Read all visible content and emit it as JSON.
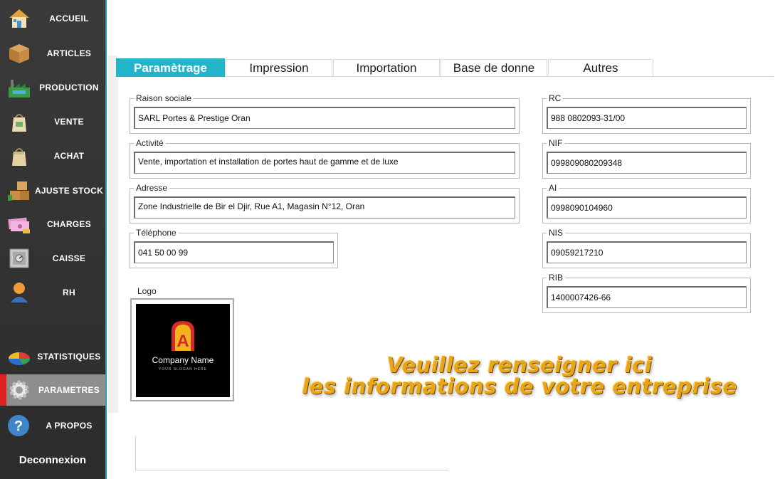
{
  "sidebar": {
    "items": [
      {
        "label": "ACCUEIL",
        "icon": "house-icon"
      },
      {
        "label": "ARTICLES",
        "icon": "wooden-crate-icon"
      },
      {
        "label": "PRODUCTION",
        "icon": "factory-icon"
      },
      {
        "label": "VENTE",
        "icon": "shopping-bag-icon"
      },
      {
        "label": "ACHAT",
        "icon": "paper-bag-icon"
      },
      {
        "label": "AJUSTE STOCK",
        "icon": "stacked-boxes-icon"
      },
      {
        "label": "CHARGES",
        "icon": "banknotes-icon"
      },
      {
        "label": "CAISSE",
        "icon": "safe-icon"
      },
      {
        "label": "RH",
        "icon": "user-icon"
      },
      {
        "label": "STATISTIQUES",
        "icon": "pie-chart-icon"
      },
      {
        "label": "PARAMETRES",
        "icon": "gear-icon"
      },
      {
        "label": "A PROPOS",
        "icon": "question-icon"
      }
    ],
    "active": "PARAMETRES",
    "logout_label": "Deconnexion"
  },
  "tabs": [
    {
      "label": "Paramètrage",
      "active": true
    },
    {
      "label": "Impression",
      "active": false
    },
    {
      "label": "Importation",
      "active": false
    },
    {
      "label": "Base de donne",
      "active": false
    },
    {
      "label": "Autres",
      "active": false
    }
  ],
  "form": {
    "raison_sociale": {
      "label": "Raison sociale",
      "value": "SARL Portes & Prestige Oran"
    },
    "activite": {
      "label": "Activité",
      "value": "Vente, importation et installation de portes haut de gamme et de luxe"
    },
    "adresse": {
      "label": "Adresse",
      "value": "Zone Industrielle de Bir el Djir, Rue A1, Magasin N°12, Oran"
    },
    "telephone": {
      "label": "Téléphone",
      "value": "041 50 00 99"
    },
    "rc": {
      "label": "RC",
      "value": "988 0802093-31/00"
    },
    "nif": {
      "label": "NIF",
      "value": "099809080209348"
    },
    "ai": {
      "label": "AI",
      "value": "0998090104960"
    },
    "nis": {
      "label": "NIS",
      "value": "09059217210"
    },
    "rib": {
      "label": "RIB",
      "value": "1400007426-66"
    }
  },
  "logo": {
    "label": "Logo",
    "company_name": "Company Name",
    "slogan": "YOUR SLOGAN HERE"
  },
  "banner": {
    "line1": "Veuillez renseigner ici",
    "line2": "les informations de votre entreprise"
  },
  "colors": {
    "accent": "#22b4c8",
    "sidebar": "#2f2f2f",
    "active_marker": "#e02020",
    "banner": "#e6a51a"
  }
}
